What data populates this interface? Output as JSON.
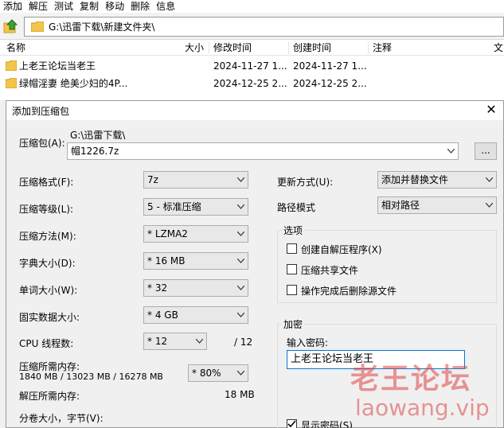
{
  "menu": [
    "添加",
    "解压",
    "测试",
    "复制",
    "移动",
    "删除",
    "信息"
  ],
  "address": {
    "path": "G:\\迅雷下载\\新建文件夹\\"
  },
  "columns": {
    "name": "名称",
    "size": "大小",
    "modified": "修改时间",
    "created": "创建时间",
    "comment": "注释",
    "trailing": "文"
  },
  "files": [
    {
      "name": "上老王论坛当老王",
      "modified": "2024-11-27 1...",
      "created": "2024-11-27 1..."
    },
    {
      "name": "绿帽淫妻 绝美少妇的4P...",
      "modified": "2024-12-25 2...",
      "created": "2024-12-25 2..."
    }
  ],
  "dialog": {
    "title": "添加到压缩包",
    "close": "✕",
    "archive_label": "压缩包(A):",
    "archive_dir": "G:\\迅雷下载\\",
    "archive_name": "帽1226.7z",
    "browse_label": "...",
    "format_label": "压缩格式(F):",
    "format_value": "7z",
    "level_label": "压缩等级(L):",
    "level_value": "5 - 标准压缩",
    "method_label": "压缩方法(M):",
    "method_value": "* LZMA2",
    "dict_label": "字典大小(D):",
    "dict_value": "* 16 MB",
    "word_label": "单词大小(W):",
    "word_value": "* 32",
    "solid_label": "固实数据大小:",
    "solid_value": "* 4 GB",
    "threads_label": "CPU 线程数:",
    "threads_value": "* 12",
    "threads_max": "/ 12",
    "mem_comp_label": "压缩所需内存:",
    "mem_comp_value": "1840 MB / 13023 MB / 16278 MB",
    "mem_pct_value": "* 80%",
    "mem_decomp_label": "解压所需内存:",
    "mem_decomp_value": "18 MB",
    "volume_label": "分卷大小，字节(V):",
    "update_label": "更新方式(U):",
    "update_value": "添加并替换文件",
    "path_label": "路径模式",
    "path_value": "相对路径",
    "options_title": "选项",
    "opt_sfx": "创建自解压程序(X)",
    "opt_shared": "压缩共享文件",
    "opt_delete": "操作完成后删除源文件",
    "encrypt_title": "加密",
    "password_label": "输入密码:",
    "password_value": "上老王论坛当老王",
    "show_password": "显示密码(S)"
  },
  "watermark": {
    "cn": "老王论坛",
    "en": "laowang.vip"
  },
  "colors": {
    "accent": "#0078d7",
    "folder": "#f3c54a",
    "watermark": "#dc4646"
  }
}
